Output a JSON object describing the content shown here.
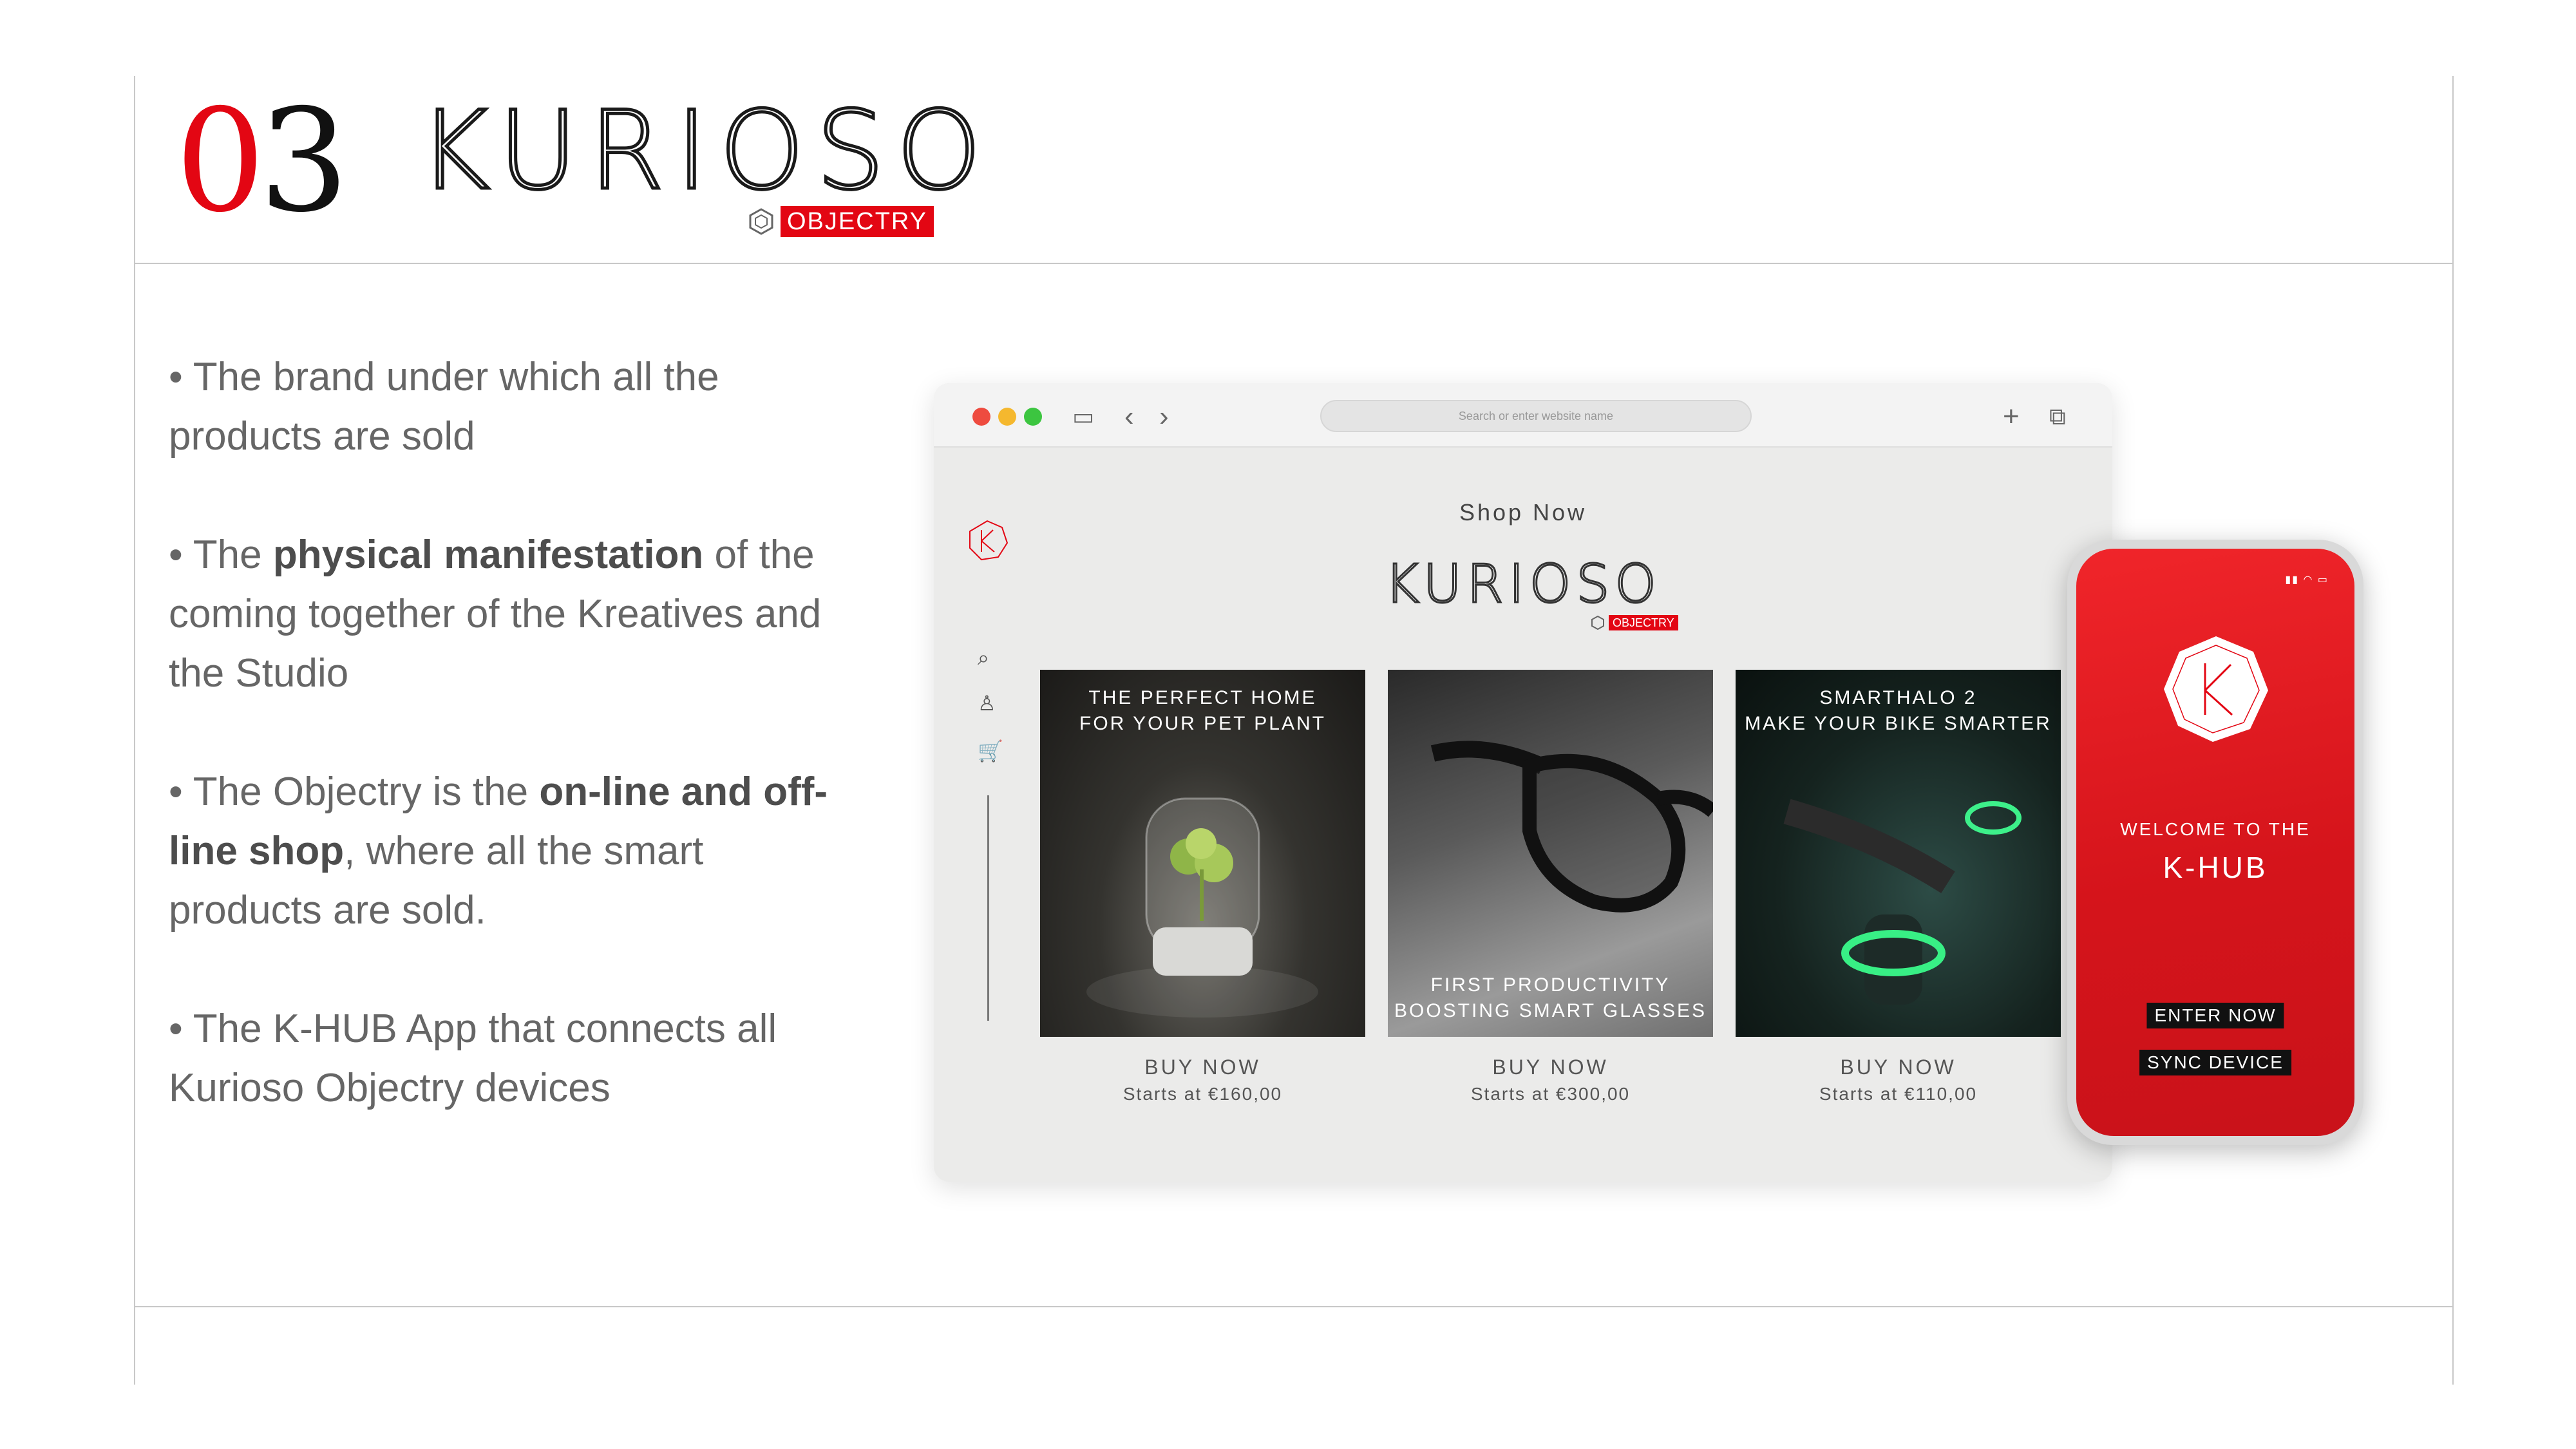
{
  "header": {
    "section_number_0": "0",
    "section_number_3": "3",
    "brand": "KURIOSO",
    "sub_brand": "OBJECTRY"
  },
  "bullets": [
    {
      "pre": "• The brand under which all the products are sold",
      "bold": "",
      "post": ""
    },
    {
      "pre": "• The ",
      "bold": "physical manifestation",
      "post": " of the coming together of the Kreatives and the Studio"
    },
    {
      "pre": "• The Objectry is the ",
      "bold": "on-line and off-line shop",
      "post": ", where all the smart products are sold."
    },
    {
      "pre": "• The K-HUB App that connects all Kurioso Objectry devices",
      "bold": "",
      "post": ""
    }
  ],
  "browser": {
    "url_placeholder": "Search or enter website name",
    "shop_now": "Shop Now",
    "brand": "KURIOSO",
    "sub_brand": "OBJECTRY",
    "products": [
      {
        "title_lines": [
          "THE PERFECT HOME",
          "FOR YOUR PET PLANT"
        ],
        "title_position": "top",
        "buy": "BUY NOW",
        "price": "Starts at €160,00"
      },
      {
        "title_lines": [
          "FIRST PRODUCTIVITY",
          "BOOSTING SMART GLASSES"
        ],
        "title_position": "bottom",
        "buy": "BUY NOW",
        "price": "Starts at €300,00"
      },
      {
        "title_lines": [
          "SMARTHALO 2",
          "MAKE YOUR BIKE SMARTER"
        ],
        "title_position": "top",
        "buy": "BUY NOW",
        "price": "Starts at €110,00"
      }
    ]
  },
  "phone": {
    "welcome": "WELCOME TO THE",
    "app_name": "K-HUB",
    "enter_button": "ENTER NOW",
    "sync_button": "SYNC DEVICE"
  },
  "colors": {
    "accent_red": "#e30613",
    "text_gray": "#666666"
  }
}
